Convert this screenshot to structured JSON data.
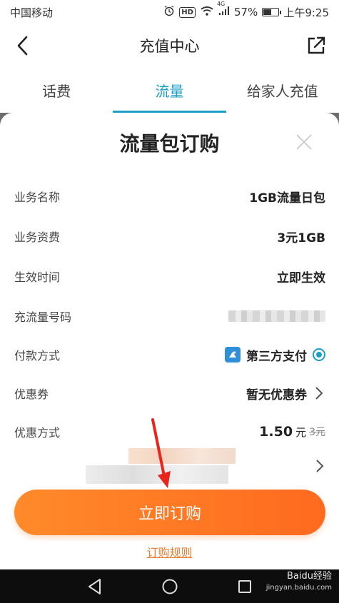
{
  "status_bar": {
    "carrier": "中国移动",
    "network": "4G",
    "battery": "57%",
    "battery_level": 0.57,
    "time": "上午9:25",
    "hd_badge": "HD"
  },
  "header": {
    "title": "充值中心"
  },
  "tabs": [
    {
      "label": "话费",
      "active": false
    },
    {
      "label": "流量",
      "active": true
    },
    {
      "label": "给家人充值",
      "active": false
    }
  ],
  "sheet": {
    "title": "流量包订购",
    "rows": {
      "business_name": {
        "label": "业务名称",
        "value": "1GB流量日包"
      },
      "business_fee": {
        "label": "业务资费",
        "value": "3元1GB"
      },
      "effective_time": {
        "label": "生效时间",
        "value": "立即生效"
      },
      "recharge_number": {
        "label": "充流量号码"
      },
      "payment_method": {
        "label": "付款方式",
        "value": "第三方支付"
      },
      "coupon": {
        "label": "优惠券",
        "value": "暂无优惠券"
      },
      "discount_method": {
        "label": "优惠方式",
        "price": "1.50",
        "price_unit": "元",
        "old_price": "3元"
      }
    },
    "order_button": "立即订购",
    "rules_link": "订购规则"
  },
  "watermark": {
    "brand": "Baidu经验",
    "url": "jingyan.baidu.com"
  },
  "colors": {
    "accent": "#1aa0c8",
    "order_orange": "#ff7a25",
    "rules_link": "#f07b2a",
    "arrow_red": "#e8241c"
  }
}
